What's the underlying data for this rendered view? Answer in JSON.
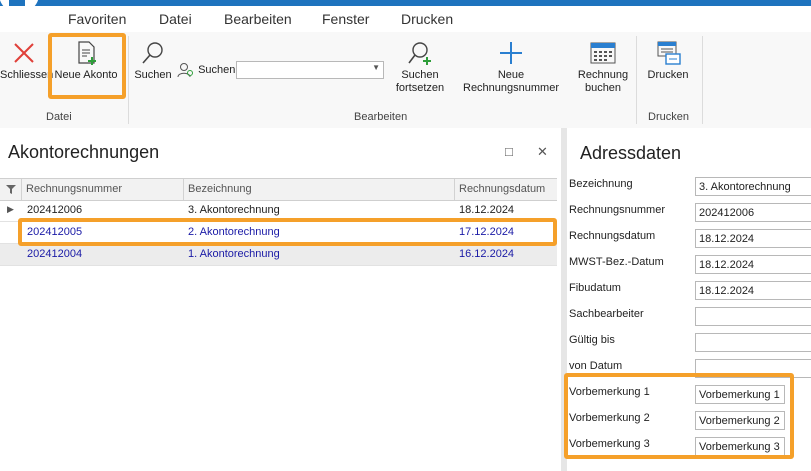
{
  "menu": [
    "Favoriten",
    "Datei",
    "Bearbeiten",
    "Fenster",
    "Drucken"
  ],
  "ribbon": {
    "close_label": "Schliessen",
    "new_akonto_label": "Neue Akonto",
    "search_label": "Suchen",
    "search_field_label": "Suchen",
    "search_field_value": "",
    "continue_search_label": [
      "Suchen",
      "fortsetzen"
    ],
    "new_invoice_number_label": "Neue Rechnungsnummer",
    "book_invoice_label": [
      "Rechnung",
      "buchen"
    ],
    "print_label": "Drucken",
    "groups": [
      "Datei",
      "Bearbeiten",
      "Drucken"
    ]
  },
  "left_panel": {
    "title": "Akontorechnungen",
    "columns": [
      "Rechnungsnummer",
      "Bezeichnung",
      "Rechnungsdatum"
    ],
    "rows": [
      [
        "202412006",
        "3. Akontorechnung",
        "18.12.2024"
      ],
      [
        "202412005",
        "2. Akontorechnung",
        "17.12.2024"
      ],
      [
        "202412004",
        "1. Akontorechnung",
        "16.12.2024"
      ]
    ]
  },
  "right_panel": {
    "title": "Adressdaten",
    "fields": [
      {
        "label": "Bezeichnung",
        "value": "3. Akontorechnung"
      },
      {
        "label": "Rechnungsnummer",
        "value": "202412006"
      },
      {
        "label": "Rechnungsdatum",
        "value": "18.12.2024"
      },
      {
        "label": "MWST-Bez.-Datum",
        "value": "18.12.2024"
      },
      {
        "label": "Fibudatum",
        "value": "18.12.2024"
      },
      {
        "label": "Sachbearbeiter",
        "value": ""
      },
      {
        "label": "Gültig bis",
        "value": ""
      },
      {
        "label": "von Datum",
        "value": ""
      },
      {
        "label": "Vorbemerkung 1",
        "value": "Vorbemerkung 1"
      },
      {
        "label": "Vorbemerkung 2",
        "value": "Vorbemerkung 2"
      },
      {
        "label": "Vorbemerkung 3",
        "value": "Vorbemerkung 3"
      }
    ]
  },
  "colors": {
    "accent": "#1e73be",
    "highlight": "#f5a02a",
    "link_text": "#1a1aa6",
    "close_red": "#e0403a"
  },
  "icons": [
    "close-icon",
    "new-document-icon",
    "search-icon",
    "user-search-icon",
    "search-continue-icon",
    "plus-icon",
    "calculator-icon",
    "printer-icon",
    "filter-icon",
    "maximize-icon"
  ]
}
